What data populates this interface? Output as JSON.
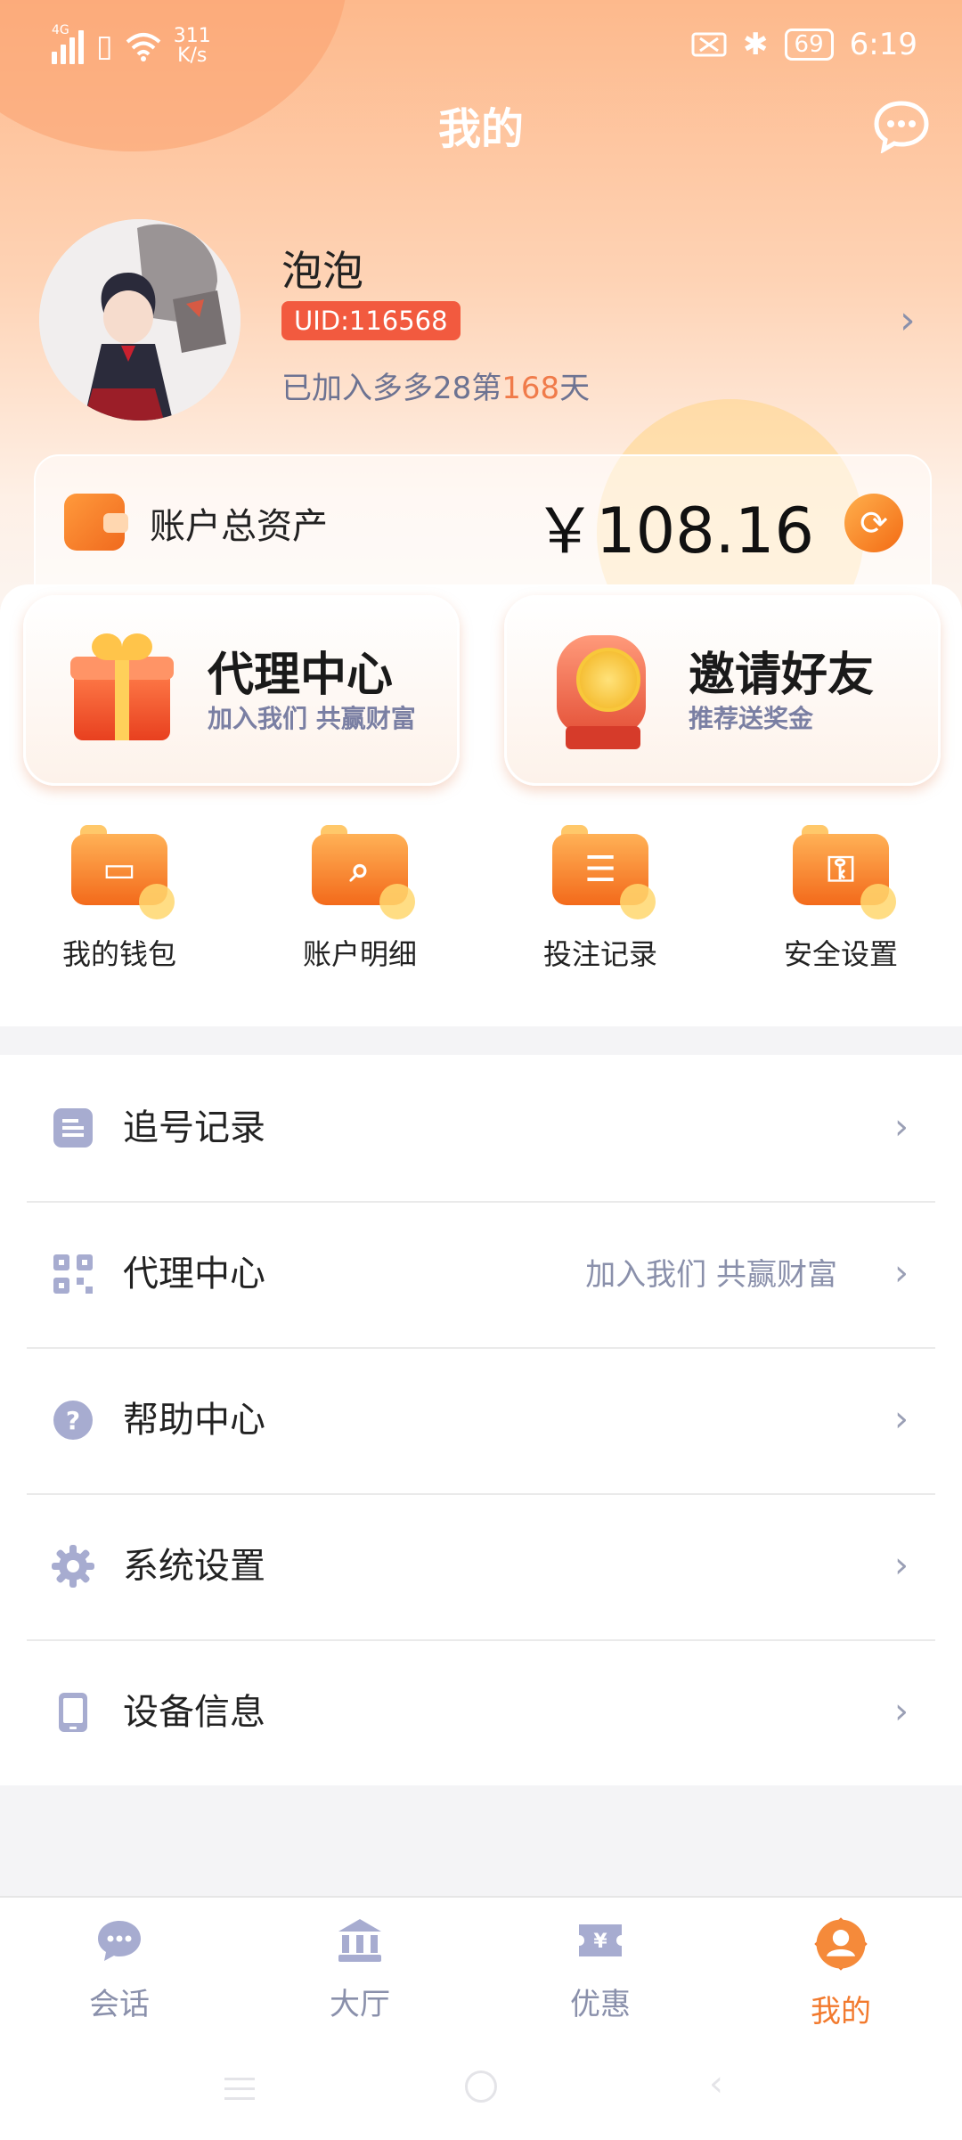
{
  "status_bar": {
    "network": "4G",
    "speed_value": "311",
    "speed_unit": "K/s",
    "battery": "69",
    "time": "6:19"
  },
  "header": {
    "title": "我的",
    "message_icon": "chat-bubble-icon"
  },
  "profile": {
    "nickname": "泡泡",
    "uid": "UID:116568",
    "joined_prefix": "已加入多多28第",
    "joined_days": "168",
    "joined_suffix": "天"
  },
  "assets": {
    "label": "账户总资产",
    "value": "￥108.16"
  },
  "promo": {
    "agent": {
      "title": "代理中心",
      "subtitle": "加入我们 共赢财富"
    },
    "invite": {
      "title": "邀请好友",
      "subtitle": "推荐送奖金"
    }
  },
  "quick_actions": [
    {
      "label": "我的钱包",
      "icon": "wallet-icon"
    },
    {
      "label": "账户明细",
      "icon": "search-icon"
    },
    {
      "label": "投注记录",
      "icon": "record-icon"
    },
    {
      "label": "安全设置",
      "icon": "key-icon"
    }
  ],
  "menu": [
    {
      "label": "追号记录",
      "extra": "",
      "icon": "document-icon"
    },
    {
      "label": "代理中心",
      "extra": "加入我们 共赢财富",
      "icon": "qrcode-icon"
    },
    {
      "label": "帮助中心",
      "extra": "",
      "icon": "help-icon"
    },
    {
      "label": "系统设置",
      "extra": "",
      "icon": "gear-icon"
    },
    {
      "label": "设备信息",
      "extra": "",
      "icon": "phone-icon"
    }
  ],
  "tabbar": [
    {
      "label": "会话",
      "icon": "chat-icon",
      "active": false
    },
    {
      "label": "大厅",
      "icon": "bank-icon",
      "active": false
    },
    {
      "label": "优惠",
      "icon": "coupon-icon",
      "active": false
    },
    {
      "label": "我的",
      "icon": "user-icon",
      "active": true
    }
  ],
  "colors": {
    "accent": "#f27a2e",
    "badge": "#f25a3f",
    "muted": "#8a90ab",
    "menu_icon": "#a7acd0"
  }
}
